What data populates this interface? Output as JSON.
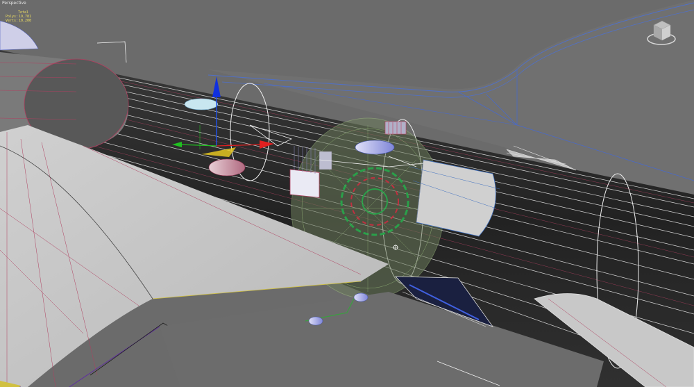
{
  "viewport": {
    "label": "Perspective",
    "stats": {
      "header": "Total",
      "rows": [
        {
          "key": "Polys:",
          "value": "19,781"
        },
        {
          "key": "Verts:",
          "value": "10,200"
        }
      ]
    }
  },
  "viewcube": {
    "icon": "viewcube-icon"
  },
  "colors": {
    "background": "#6a6a6a",
    "fuselage": "#2d2d2d",
    "wing": "#c6c6c6",
    "wire_white": "#ffffff",
    "wire_red": "#c83c50",
    "wire_blue": "#3c64c8",
    "wire_green": "#3cb44a",
    "gizmo_x": "#e02020",
    "gizmo_y": "#20c020",
    "gizmo_z": "#2020e0"
  }
}
